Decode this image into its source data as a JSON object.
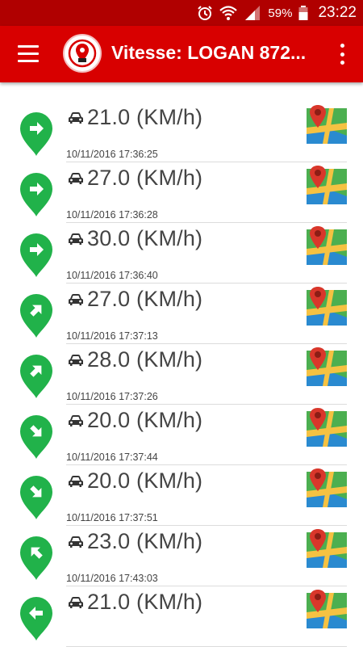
{
  "status_bar": {
    "battery": "59%",
    "time": "23:22"
  },
  "app_bar": {
    "title": "Vitesse: LOGAN 872..."
  },
  "colors": {
    "app_bar": "#d80000",
    "status_bar": "#b00000",
    "pin": "#21b24a",
    "map_pin": "#d9372b"
  },
  "records": [
    {
      "speed": "21.0 (KM/h)",
      "timestamp": "10/11/2016 17:36:25",
      "direction_deg": 0
    },
    {
      "speed": "27.0 (KM/h)",
      "timestamp": "10/11/2016 17:36:28",
      "direction_deg": 0
    },
    {
      "speed": "30.0 (KM/h)",
      "timestamp": "10/11/2016 17:36:40",
      "direction_deg": 0
    },
    {
      "speed": "27.0 (KM/h)",
      "timestamp": "10/11/2016 17:37:13",
      "direction_deg": -45
    },
    {
      "speed": "28.0 (KM/h)",
      "timestamp": "10/11/2016 17:37:26",
      "direction_deg": -45
    },
    {
      "speed": "20.0 (KM/h)",
      "timestamp": "10/11/2016 17:37:44",
      "direction_deg": 45
    },
    {
      "speed": "20.0 (KM/h)",
      "timestamp": "10/11/2016 17:37:51",
      "direction_deg": 45
    },
    {
      "speed": "23.0 (KM/h)",
      "timestamp": "10/11/2016 17:43:03",
      "direction_deg": -135
    },
    {
      "speed": "21.0 (KM/h)",
      "timestamp": "",
      "direction_deg": 180
    }
  ]
}
